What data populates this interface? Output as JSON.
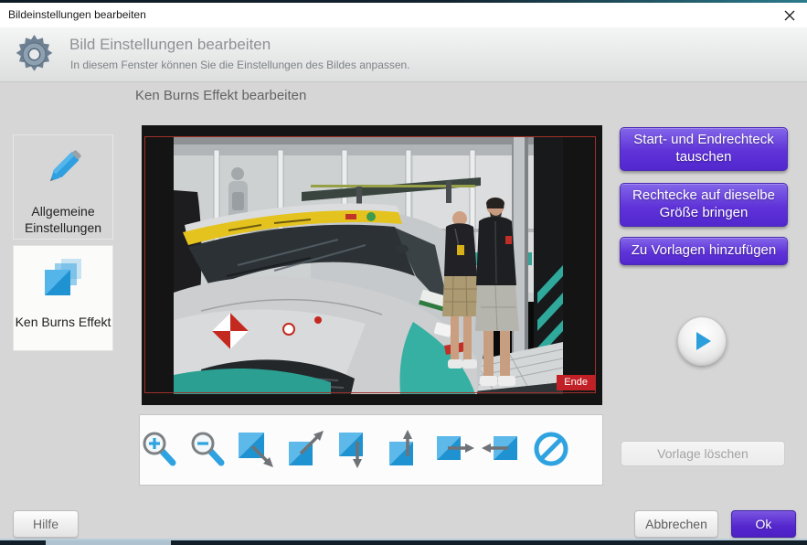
{
  "window": {
    "title": "Bildeinstellungen bearbeiten"
  },
  "header": {
    "title": "Bild Einstellungen bearbeiten",
    "subtitle": "In diesem Fenster können Sie die Einstellungen des Bildes anpassen."
  },
  "sidebar": {
    "items": [
      {
        "label": "Allgemeine Einstellungen",
        "icon": "pen-icon",
        "selected": false
      },
      {
        "label": "Ken Burns Effekt",
        "icon": "layers-icon",
        "selected": true
      }
    ]
  },
  "main": {
    "section_title": "Ken Burns Effekt bearbeiten",
    "preview": {
      "end_label": "Ende"
    }
  },
  "toolbar": {
    "icons": [
      "zoom-in",
      "zoom-out",
      "resize-down-right",
      "resize-up-right",
      "move-down",
      "move-up",
      "move-right",
      "move-left",
      "cancel"
    ]
  },
  "actions": {
    "swap_rects": "Start- und Endrechteck tauschen",
    "same_size": "Rechtecke auf dieselbe Größe bringen",
    "add_template": "Zu Vorlagen hinzufügen",
    "delete_template": "Vorlage löschen"
  },
  "footer": {
    "help": "Hilfe",
    "cancel": "Abbrechen",
    "ok": "Ok"
  },
  "colors": {
    "accent_purple": "#5f33d8",
    "accent_blue": "#2fa3e0",
    "end_badge_red": "#c12126",
    "red_rect_border": "#a03028"
  }
}
